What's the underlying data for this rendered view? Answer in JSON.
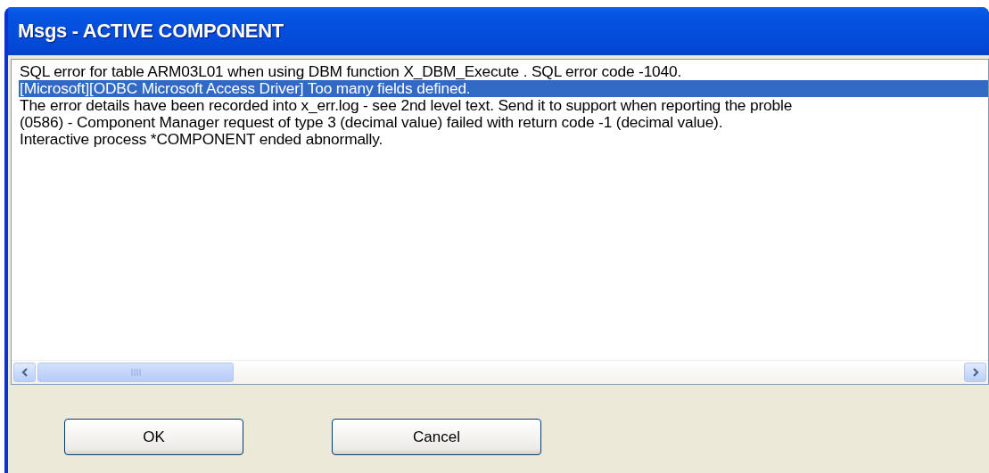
{
  "window": {
    "title": "Msgs - ACTIVE COMPONENT"
  },
  "messages": [
    {
      "text": "SQL error for table ARM03L01 when using DBM function X_DBM_Execute . SQL error code -1040.",
      "selected": false
    },
    {
      "text": "[Microsoft][ODBC Microsoft Access Driver] Too many fields defined.",
      "selected": true
    },
    {
      "text": "The error details have been recorded into x_err.log - see 2nd level text. Send it to support when reporting the proble",
      "selected": false
    },
    {
      "text": "(0586) - Component Manager request of type 3 (decimal value) failed with return code -1 (decimal value).",
      "selected": false
    },
    {
      "text": "Interactive process *COMPONENT ended abnormally.",
      "selected": false
    }
  ],
  "buttons": [
    "OK",
    "Cancel"
  ]
}
